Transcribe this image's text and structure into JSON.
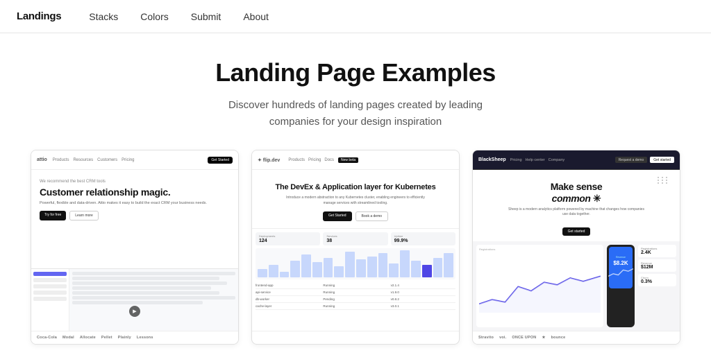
{
  "nav": {
    "brand": "Landings",
    "items": [
      "Stacks",
      "Colors",
      "Submit",
      "About"
    ]
  },
  "hero": {
    "title": "Landing Page Examples",
    "subtitle": "Discover hundreds of landing pages created by leading companies for your design inspiration"
  },
  "cards": [
    {
      "id": "attio",
      "topbar": {
        "logo": "attio",
        "nav": [
          "Products",
          "Resources",
          "Customers",
          "Pricing"
        ],
        "cta": "Get Started"
      },
      "headline": "Customer relationship magic.",
      "tagline": "We recommend the best CRM tools",
      "subtext": "Powerful, flexible and data-driven. Attio makes it easy to build the exact CRM your business needs.",
      "cta1": "Try for free",
      "cta2": "Learn more",
      "footer_logos": [
        "Coca-Cola",
        "Modal",
        "Allocate",
        "Pellet",
        "Plainly",
        "Lessons"
      ]
    },
    {
      "id": "flipdev",
      "topbar": {
        "logo": "flip.dev",
        "nav": [
          "Products",
          "Pricing",
          "Docs"
        ],
        "badge": "New beta"
      },
      "headline": "The DevEx & Application layer for Kubernetes",
      "subtext": "Introduce a modern abstraction to any Kubernetes cluster, enabling engineers to efficiently manage services with streamlined tooling.",
      "cta1": "Get Started",
      "cta2": "Book a demo",
      "metrics": [
        {
          "label": "Deployments",
          "value": "124"
        },
        {
          "label": "Services",
          "value": "38"
        },
        {
          "label": "Uptime",
          "value": "99.9%"
        }
      ],
      "chart_bars": [
        30,
        45,
        20,
        60,
        80,
        55,
        70,
        40,
        90,
        65,
        75,
        85,
        50,
        95,
        60,
        45,
        70,
        85
      ],
      "footer_logos": []
    },
    {
      "id": "sheep",
      "topbar": {
        "logo": "BlackSheep",
        "nav": [
          "Pricing",
          "Help center",
          "Company"
        ],
        "btn_secondary": "Request a demo",
        "btn_primary": "Get started"
      },
      "headline": "Make sense",
      "headline_italic": "common",
      "subtext": "Sheep is a modern analytics platform powered by machine that changes how companies use data together.",
      "cta": "Get started",
      "stats": [
        {
          "label": "Registrations",
          "value": "2.4K"
        },
        {
          "label": "Revenue",
          "value": "$12M"
        },
        {
          "label": "Churn",
          "value": "0.3%"
        }
      ],
      "phone_label": "Revenue",
      "phone_value": "$8.2K",
      "footer_logos": [
        "Stravito",
        "voi.",
        "ONCE UPON",
        "⭐",
        "bounce"
      ]
    }
  ]
}
